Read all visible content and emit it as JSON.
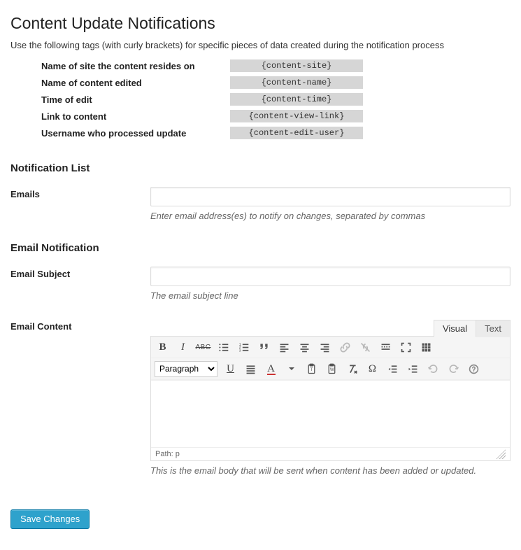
{
  "page": {
    "title": "Content Update Notifications",
    "intro": "Use the following tags (with curly brackets) for specific pieces of data created during the notification process"
  },
  "tags": [
    {
      "label": "Name of site the content resides on",
      "value": "{content-site}"
    },
    {
      "label": "Name of content edited",
      "value": "{content-name}"
    },
    {
      "label": "Time of edit",
      "value": "{content-time}"
    },
    {
      "label": "Link to content",
      "value": "{content-view-link}"
    },
    {
      "label": "Username who processed update",
      "value": "{content-edit-user}"
    }
  ],
  "sections": {
    "notification_list": "Notification List",
    "email_notification": "Email Notification"
  },
  "emails": {
    "label": "Emails",
    "value": "",
    "desc": "Enter email address(es) to notify on changes, separated by commas"
  },
  "subject": {
    "label": "Email Subject",
    "value": "",
    "desc": "The email subject line"
  },
  "content": {
    "label": "Email Content",
    "desc": "This is the email body that will be sent when content has been added or updated."
  },
  "editor": {
    "tabs": {
      "visual": "Visual",
      "text": "Text"
    },
    "format_select": "Paragraph",
    "status_path": "Path: p",
    "toolbar1": [
      "bold",
      "italic",
      "strikethrough",
      "bullet-list",
      "numbered-list",
      "blockquote",
      "align-left",
      "align-center",
      "align-right",
      "link",
      "unlink",
      "insert-more",
      "fullscreen",
      "toolbar-toggle"
    ],
    "toolbar2": [
      "format-select",
      "underline",
      "align-justify",
      "text-color",
      "paste-text",
      "paste-word",
      "clear-formatting",
      "special-char",
      "outdent",
      "indent",
      "undo",
      "redo",
      "help"
    ]
  },
  "actions": {
    "save": "Save Changes"
  }
}
